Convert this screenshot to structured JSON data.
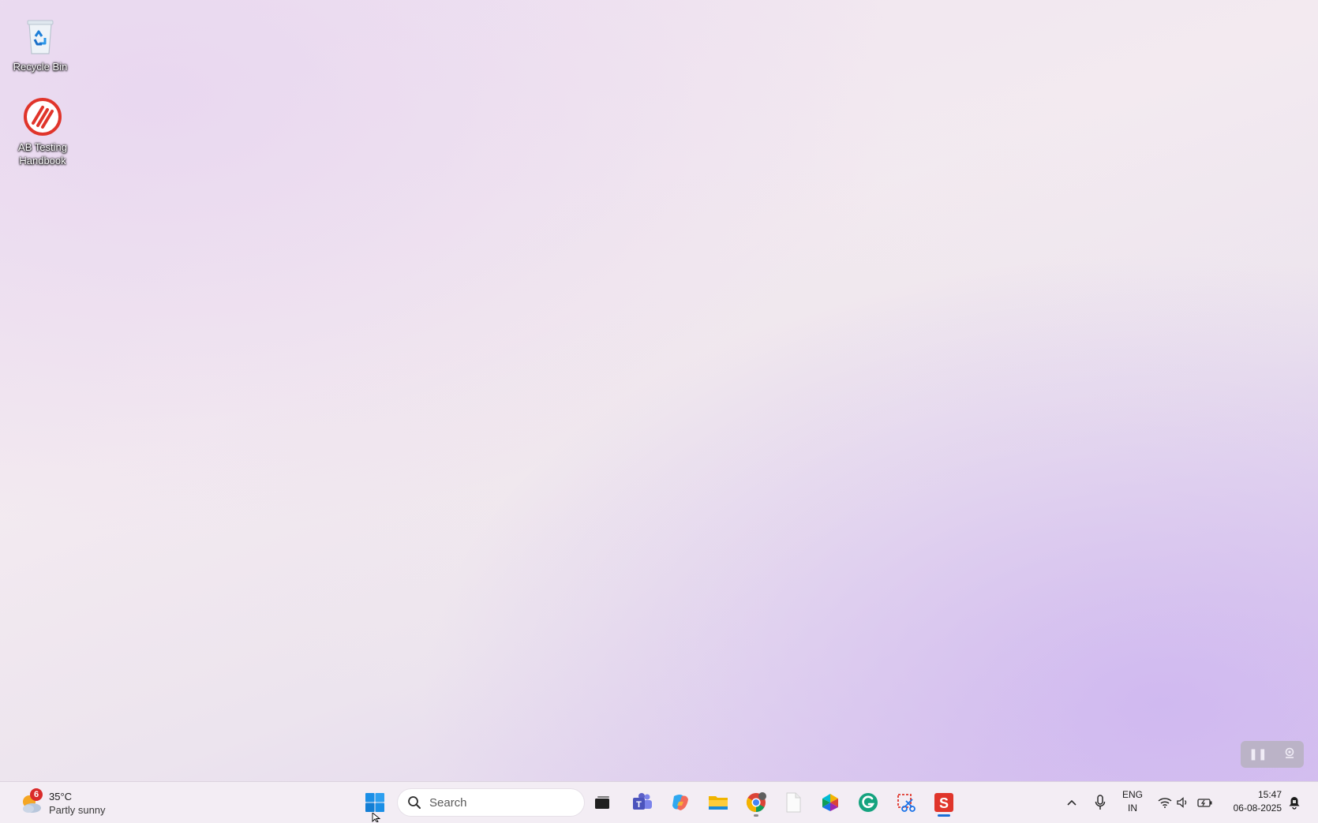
{
  "desktop": {
    "icons": [
      {
        "label": "Recycle Bin",
        "icon": "recycle-bin-icon"
      },
      {
        "label": "AB Testing Handbook",
        "icon": "ab-testing-handbook-icon"
      }
    ]
  },
  "recorder": {
    "pause_icon": "pause-icon",
    "stop_icon": "webcam-icon"
  },
  "taskbar": {
    "weather": {
      "badge": "6",
      "temperature": "35°C",
      "condition": "Partly sunny",
      "icon": "partly-sunny-icon"
    },
    "start_icon": "windows-start-icon",
    "search": {
      "placeholder": "Search",
      "icon": "search-icon"
    },
    "apps": [
      {
        "name": "Task View",
        "icon": "task-view-icon"
      },
      {
        "name": "Microsoft Teams",
        "icon": "teams-icon"
      },
      {
        "name": "Copilot",
        "icon": "copilot-icon"
      },
      {
        "name": "File Explorer",
        "icon": "file-explorer-icon"
      },
      {
        "name": "Google Chrome",
        "icon": "chrome-icon",
        "running": true
      },
      {
        "name": "Blank File",
        "icon": "blank-file-icon"
      },
      {
        "name": "Photos",
        "icon": "photos-icon"
      },
      {
        "name": "Grammarly",
        "icon": "grammarly-icon"
      },
      {
        "name": "Snipping Tool",
        "icon": "snipping-tool-icon"
      },
      {
        "name": "Screencast App",
        "icon": "screencast-s-icon",
        "active": true
      }
    ],
    "tray": {
      "chevron_icon": "chevron-up-icon",
      "mic_icon": "microphone-icon",
      "lang_line1": "ENG",
      "lang_line2": "IN",
      "wifi_icon": "wifi-icon",
      "volume_icon": "volume-icon",
      "battery_icon": "battery-icon",
      "time": "15:47",
      "date": "06-08-2025",
      "notification_icon": "notification-bell-icon"
    }
  },
  "colors": {
    "accent": "#1a6fd6",
    "taskbar_bg": "#f3edf4",
    "weather_badge": "#d92b2b",
    "ab_icon_red": "#e0352b"
  }
}
